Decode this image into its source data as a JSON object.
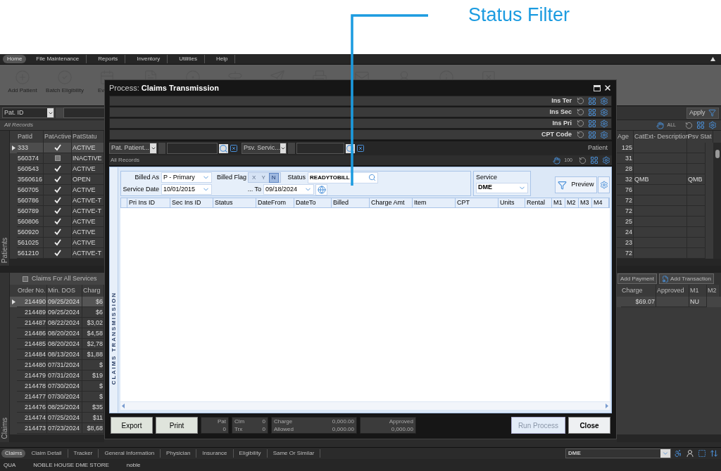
{
  "annotation": {
    "label": "Status Filter"
  },
  "menu": [
    {
      "label": "Home",
      "selected": true
    },
    {
      "label": "File Maintenance",
      "selected": false
    },
    {
      "label": "Reports",
      "selected": false
    },
    {
      "label": "Inventory",
      "selected": false
    },
    {
      "label": "Utilities",
      "selected": false
    },
    {
      "label": "Help",
      "selected": false
    }
  ],
  "toolbar": [
    {
      "label": "Add Patient",
      "kind": "plus"
    },
    {
      "label": "Batch Eligibility",
      "kind": "check"
    },
    {
      "label": "Ev",
      "kind": "calendar"
    }
  ],
  "patient_filter": {
    "field": "Pat. ID",
    "apply": "Apply"
  },
  "patient_grid": {
    "caption": "All Records",
    "all_label": "ALL",
    "side_tab": "Patients",
    "columns_left": [
      "PatId",
      "PatActive",
      "PatStatu"
    ],
    "columns_right": [
      "Age",
      "CatExt- Description",
      "Psv Stat"
    ],
    "rows": [
      {
        "pat_id": "333",
        "active": true,
        "status": "ACTIVE",
        "age": "125",
        "selected": true
      },
      {
        "pat_id": "560374",
        "active": false,
        "status": "INACTIVE",
        "age": "31",
        "selected": false
      },
      {
        "pat_id": "560543",
        "active": true,
        "status": "ACTIVE",
        "age": "28",
        "selected": false
      },
      {
        "pat_id": "3560616",
        "active": true,
        "status": "OPEN",
        "age": "32",
        "cat_ext": "QMB",
        "psv_stat": "QMB",
        "selected": false
      },
      {
        "pat_id": "560705",
        "active": true,
        "status": "ACTIVE",
        "age": "76",
        "selected": false
      },
      {
        "pat_id": "560786",
        "active": true,
        "status": "ACTIVE-T",
        "age": "72",
        "selected": false
      },
      {
        "pat_id": "560789",
        "active": true,
        "status": "ACTIVE-T",
        "age": "72",
        "selected": false
      },
      {
        "pat_id": "560806",
        "active": true,
        "status": "ACTIVE",
        "age": "25",
        "selected": false
      },
      {
        "pat_id": "560920",
        "active": true,
        "status": "ACTIVE",
        "age": "24",
        "selected": false
      },
      {
        "pat_id": "561025",
        "active": true,
        "status": "ACTIVE",
        "age": "23",
        "selected": false
      },
      {
        "pat_id": "561210",
        "active": true,
        "status": "ACTIVE-T",
        "age": "72",
        "selected": false
      }
    ]
  },
  "claims": {
    "side_tab": "Claims",
    "title": "Claims For All Services",
    "checked": false,
    "columns_left": [
      "Order No.",
      "Min. DOS",
      "Charg"
    ],
    "buttons": [
      "Add Payment",
      "Add Transaction"
    ],
    "columns_right": [
      "Charge",
      "Approved",
      "M1",
      "M2"
    ],
    "rows": [
      {
        "order": "214490",
        "dos": "09/25/2024",
        "charge": "$6",
        "selected": true
      },
      {
        "order": "214489",
        "dos": "09/25/2024",
        "charge": "$6",
        "selected": false
      },
      {
        "order": "214487",
        "dos": "08/22/2024",
        "charge": "$3,02",
        "selected": false
      },
      {
        "order": "214486",
        "dos": "08/20/2024",
        "charge": "$4,58",
        "selected": false
      },
      {
        "order": "214485",
        "dos": "08/20/2024",
        "charge": "$2,78",
        "selected": false
      },
      {
        "order": "214484",
        "dos": "08/13/2024",
        "charge": "$1,88",
        "selected": false
      },
      {
        "order": "214480",
        "dos": "07/31/2024",
        "charge": "$",
        "selected": false
      },
      {
        "order": "214479",
        "dos": "07/31/2024",
        "charge": "$19",
        "selected": false
      },
      {
        "order": "214478",
        "dos": "07/30/2024",
        "charge": "$",
        "selected": false
      },
      {
        "order": "214477",
        "dos": "07/30/2024",
        "charge": "$",
        "selected": false
      },
      {
        "order": "214476",
        "dos": "08/25/2024",
        "charge": "$35",
        "selected": false
      },
      {
        "order": "214474",
        "dos": "07/25/2024",
        "charge": "$11",
        "selected": false
      },
      {
        "order": "214473",
        "dos": "07/23/2024",
        "charge": "$8,68",
        "selected": false
      }
    ],
    "detail_rows": [
      {
        "charge": "$69.07",
        "m1": "NU"
      }
    ]
  },
  "bottom_tabs": [
    {
      "label": "Claims",
      "selected": true
    },
    {
      "label": "Claim Detail",
      "selected": false
    },
    {
      "label": "Tracker",
      "selected": false
    },
    {
      "label": "General Information",
      "selected": false
    },
    {
      "label": "Physician",
      "selected": false
    },
    {
      "label": "Insurance",
      "selected": false
    },
    {
      "label": "Eligibility",
      "selected": false
    },
    {
      "label": "Same Or Similar",
      "selected": false
    }
  ],
  "service_select": "DME",
  "status_bar": [
    "QUA",
    "NOBLE HOUSE DME STORE",
    "noble"
  ],
  "modal": {
    "title_prefix": "Process:",
    "title": "Claims Transmission",
    "filter_bars": [
      "Ins Ter",
      "Ins Sec",
      "Ins Pri",
      "CPT Code"
    ],
    "patient_field": "Pat. Patient...",
    "service_field": "Psv. Servic...",
    "right_label": "Patient",
    "caption": "All Records",
    "page_size": "100",
    "side_label": "CLAIMS TRANSMISSION",
    "form": {
      "billed_as": {
        "label": "Billed As",
        "value": "P - Primary"
      },
      "billed_flag": {
        "label": "Billed Flag",
        "options": [
          {
            "label": "X",
            "selected": false
          },
          {
            "label": "Y",
            "selected": false
          },
          {
            "label": "N",
            "selected": true
          }
        ]
      },
      "status": {
        "label": "Status",
        "value": "READYTOBILL"
      },
      "service_date": {
        "label": "Service Date",
        "value": "10/01/2015"
      },
      "to": {
        "label": "... To",
        "value": "09/18/2024"
      },
      "service": {
        "label": "Service",
        "value": "DME"
      },
      "preview": "Preview"
    },
    "columns": [
      "Pri Ins ID",
      "Sec Ins ID",
      "Status",
      "DateFrom",
      "DateTo",
      "Billed",
      "Charge Amt",
      "Item",
      "CPT",
      "Units",
      "Rental",
      "M1",
      "M2",
      "M3",
      "M4"
    ],
    "footer": {
      "export": "Export",
      "print": "Print",
      "pat": {
        "label": "Pat",
        "value": "0"
      },
      "counts": [
        {
          "label": "Clm",
          "value": "0"
        },
        {
          "label": "Trx",
          "value": "0"
        }
      ],
      "amounts": [
        {
          "label": "Charge",
          "value": "0,000.00"
        },
        {
          "label": "Allowed",
          "value": "0,000.00"
        }
      ],
      "approved": {
        "label": "Approved",
        "value": "0,000.00"
      },
      "run": {
        "label": "Run Process",
        "disabled": true
      },
      "close": "Close"
    }
  }
}
